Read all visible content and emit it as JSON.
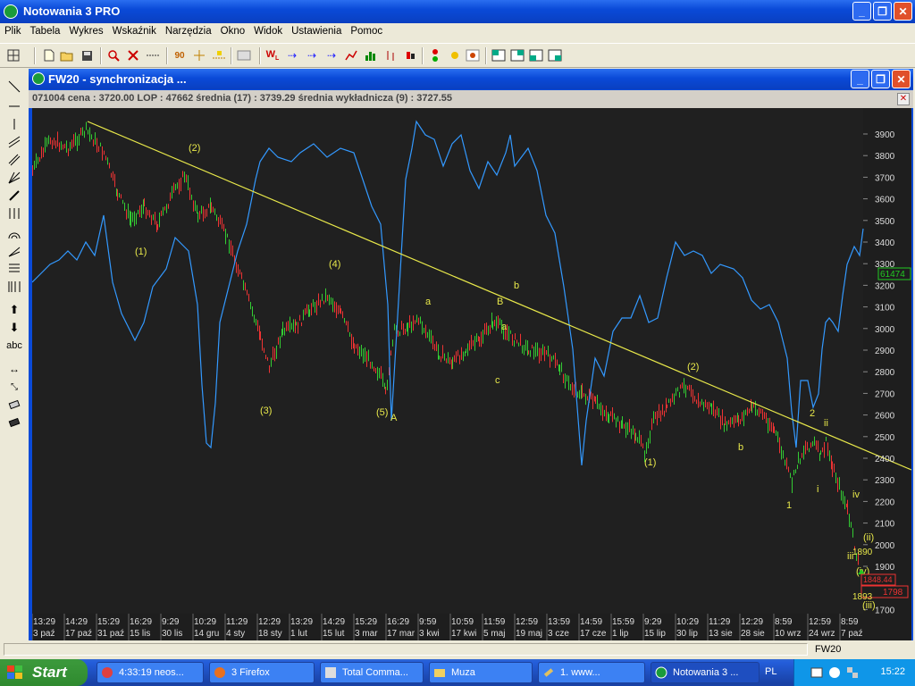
{
  "app": {
    "title": "Notowania 3 PRO"
  },
  "menu": [
    "Plik",
    "Tabela",
    "Wykres",
    "Wskaźnik",
    "Narzędzia",
    "Okno",
    "Widok",
    "Ustawienia",
    "Pomoc"
  ],
  "child_window": {
    "title": "FW20 - synchronizacja ...",
    "info": "071004  cena : 3720.00 LOP : 47662 średnia (17) : 3739.29 średnia wykładnicza (9) : 3727.55"
  },
  "chart": {
    "colors": {
      "background": "#1e1e1e",
      "price_line": "#3399ff",
      "trend_line": "#e8e84a",
      "label": "#e8e84a",
      "up": "#33cc33",
      "down": "#ee3333"
    },
    "y_axis_ticks": [
      "3900",
      "3800",
      "3700",
      "3600",
      "3500",
      "3400",
      "3300",
      "3200",
      "3100",
      "3000",
      "2900",
      "2800",
      "2700",
      "2600",
      "2500",
      "2400",
      "2300",
      "2200",
      "2100",
      "2000",
      "1900",
      "1800",
      "1700"
    ],
    "x_time_labels": [
      "13:29",
      "14:29",
      "15:29",
      "16:29",
      "9:29",
      "10:29",
      "11:29",
      "12:29",
      "13:29",
      "14:29",
      "15:29",
      "16:29",
      "9:59",
      "10:59",
      "11:59",
      "12:59",
      "13:59",
      "14:59",
      "15:59",
      "9:29",
      "10:29",
      "11:29",
      "12:29",
      "8:59",
      "12:59",
      "8:59"
    ],
    "x_date_labels": [
      "3 paź",
      "17 paź",
      "31 paź",
      "15 lis",
      "30 lis",
      "14 gru",
      "4 sty",
      "18 sty",
      "1 lut",
      "15 lut",
      "3 mar",
      "17 mar",
      "3 kwi",
      "17 kwi",
      "5 maj",
      "19 maj",
      "3 cze",
      "17 cze",
      "1 lip",
      "15 lip",
      "30 lip",
      "13 sie",
      "28 sie",
      "10 wrz",
      "24 wrz",
      "7 paź"
    ],
    "wave_labels": [
      "(2)",
      "(1)",
      "(3)",
      "(4)",
      "(5)",
      "A",
      "a",
      "c",
      "B",
      "b",
      "a",
      "(2)",
      "(1)",
      "b",
      "1",
      "2",
      "ii",
      "i",
      "iv",
      "(ii)",
      "iii",
      "(iii)",
      "(iv)"
    ],
    "price_badges": {
      "current": "61474",
      "b1": "1848.44",
      "b2": "1798"
    },
    "small_labels": {
      "l1": "1890",
      "l2": "1893"
    }
  },
  "statusbar": {
    "symbol": "FW20"
  },
  "taskbar": {
    "start": "Start",
    "tasks": [
      "4:33:19 neos...",
      "3 Firefox",
      "Total Comma...",
      "Muza",
      "1.         www...",
      "Notowania 3 ..."
    ],
    "lang": "PL",
    "clock": "15:22"
  }
}
